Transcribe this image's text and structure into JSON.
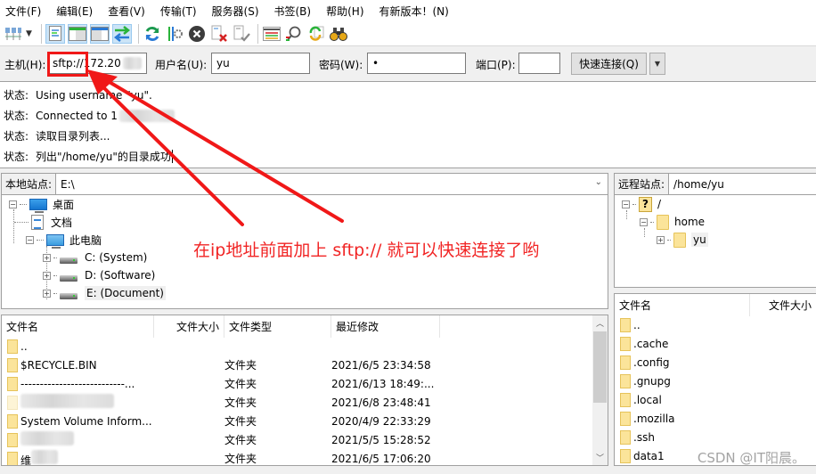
{
  "menu": [
    {
      "label": "文件(F)"
    },
    {
      "label": "编辑(E)"
    },
    {
      "label": "查看(V)"
    },
    {
      "label": "传输(T)"
    },
    {
      "label": "服务器(S)"
    },
    {
      "label": "书签(B)"
    },
    {
      "label": "帮助(H)"
    },
    {
      "label": "有新版本！(N)"
    }
  ],
  "toolbar": {
    "icons": [
      "site-manager-icon",
      "toggle-message-log-icon",
      "toggle-local-tree-icon",
      "toggle-remote-tree-icon",
      "toggle-transfer-queue-icon",
      "refresh-icon",
      "process-queue-icon",
      "cancel-icon",
      "disconnect-icon",
      "reconnect-icon",
      "directory-filter-icon",
      "search-icon",
      "synchronized-browsing-icon",
      "find-files-icon"
    ]
  },
  "quickconnect": {
    "host_label": "主机(H):",
    "host_value": "sftp://172.20",
    "user_label": "用户名(U):",
    "user_value": "yu",
    "pass_label": "密码(W):",
    "pass_value": "•",
    "port_label": "端口(P):",
    "port_value": "",
    "connect_button": "快速连接(Q)"
  },
  "log": [
    {
      "label": "状态:",
      "text": "Using username \"yu\"."
    },
    {
      "label": "状态:",
      "text": "Connected to 1"
    },
    {
      "label": "状态:",
      "text": "读取目录列表..."
    },
    {
      "label": "状态:",
      "text": "列出\"/home/yu\"的目录成功"
    }
  ],
  "local_site": {
    "label": "本地站点:",
    "path": "E:\\",
    "tree": [
      {
        "label": "桌面",
        "icon": "desktop-icon"
      },
      {
        "label": "文档",
        "icon": "documents-icon"
      },
      {
        "label": "此电脑",
        "icon": "computer-icon"
      },
      {
        "label": "C: (System)",
        "icon": "drive-icon"
      },
      {
        "label": "D: (Software)",
        "icon": "drive-icon"
      },
      {
        "label": "E: (Document)",
        "icon": "drive-icon"
      }
    ],
    "columns": [
      "文件名",
      "文件大小",
      "文件类型",
      "最近修改"
    ],
    "files": [
      {
        "name": "..",
        "size": "",
        "type": "",
        "modified": ""
      },
      {
        "name": "$RECYCLE.BIN",
        "size": "",
        "type": "文件夹",
        "modified": "2021/6/5 23:34:58"
      },
      {
        "name": "---------------------------...",
        "size": "",
        "type": "文件夹",
        "modified": "2021/6/13 18:49:..."
      },
      {
        "name": "",
        "size": "",
        "type": "文件夹",
        "modified": "2021/6/8 23:48:41"
      },
      {
        "name": "System Volume Inform...",
        "size": "",
        "type": "文件夹",
        "modified": "2020/4/9 22:33:29"
      },
      {
        "name": "",
        "size": "",
        "type": "文件夹",
        "modified": "2021/5/5 15:28:52"
      },
      {
        "name": "维",
        "size": "",
        "type": "文件夹",
        "modified": "2021/6/5 17:06:20"
      }
    ]
  },
  "remote_site": {
    "label": "远程站点:",
    "path": "/home/yu",
    "tree": [
      {
        "label": "/",
        "icon": "unknown-folder-icon"
      },
      {
        "label": "home",
        "icon": "folder-icon"
      },
      {
        "label": "yu",
        "icon": "folder-icon"
      }
    ],
    "columns": [
      "文件名",
      "文件大小"
    ],
    "files": [
      {
        "name": ".."
      },
      {
        "name": ".cache"
      },
      {
        "name": ".config"
      },
      {
        "name": ".gnupg"
      },
      {
        "name": ".local"
      },
      {
        "name": ".mozilla"
      },
      {
        "name": ".ssh"
      },
      {
        "name": "data1"
      }
    ]
  },
  "annotation": {
    "text": "在ip地址前面加上 sftp:// 就可以快速连接了哟",
    "color": "#f12424"
  },
  "watermark": "CSDN @IT阳晨。"
}
